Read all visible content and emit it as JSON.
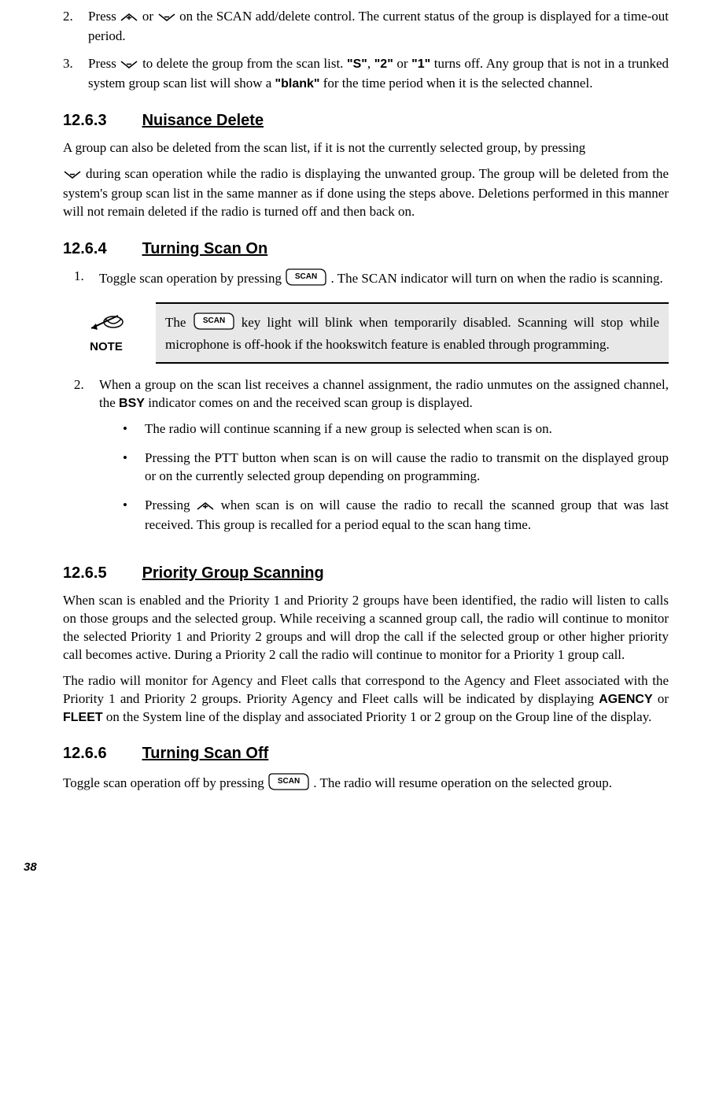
{
  "item2": {
    "num": "2.",
    "text_a": "Press ",
    "text_b": " or ",
    "text_c": " on the SCAN add/delete control. The current status of the group is displayed for a time-out period."
  },
  "item3": {
    "num": "3.",
    "text_a": "Press ",
    "text_b": " to delete the group from the scan list.  ",
    "q_s": "\"S\"",
    "comma1": ", ",
    "q_2": "\"2\"",
    "or": " or ",
    "q_1": "\"1\"",
    "text_c": " turns off. Any group that is not in a trunked system group scan list will show a ",
    "q_blank": "\"blank\"",
    "text_d": " for the time period when it is the selected channel."
  },
  "s1263": {
    "num": "12.6.3",
    "title": "Nuisance Delete"
  },
  "p1263a": "A group can also be deleted from the scan list, if it is not the currently selected group, by pressing",
  "p1263b": " during scan operation while the radio is displaying the unwanted group. The group will be deleted from the system's group scan list in the same manner as if done using the steps above. Deletions performed in this manner will not remain deleted if the radio is turned off and then back on.",
  "s1264": {
    "num": "12.6.4",
    "title": "Turning Scan On"
  },
  "li1264_1": {
    "num": "1.",
    "a": "Toggle scan operation by pressing ",
    "b": ". The SCAN indicator will turn on when the radio is scanning."
  },
  "note": {
    "label": "NOTE",
    "a": "The ",
    "b": " key light will blink when temporarily disabled. Scanning will stop while microphone is off-hook if the hookswitch feature is enabled through programming."
  },
  "li1264_2": {
    "num": "2.",
    "a": "When a group on the scan list receives a channel assignment, the radio unmutes on the assigned channel, the ",
    "bsy": "BSY",
    "b": " indicator comes on and the received scan group is displayed."
  },
  "sub1": "The radio will continue scanning if a new group is selected when scan is on.",
  "sub2": "Pressing the PTT button when scan is on will cause the radio to transmit on the displayed group or on the currently selected group depending on programming.",
  "sub3a": "Pressing ",
  "sub3b": " when scan is on will cause the radio to recall the scanned group that was last received. This group is recalled for a period equal to the scan hang time.",
  "s1265": {
    "num": "12.6.5",
    "title": "Priority Group Scanning"
  },
  "p1265a": "When scan is enabled and the Priority 1 and Priority 2 groups have been identified, the radio will listen to calls on those groups and the selected group.  While receiving a scanned group call, the radio will continue to monitor the selected Priority 1 and Priority 2 groups and will drop the call if the selected group or other higher priority call becomes active.  During a Priority 2 call the radio will continue to monitor for a Priority 1 group call.",
  "p1265b_a": "The radio will monitor for Agency and Fleet calls that correspond to the Agency and Fleet associated with the Priority 1 and Priority 2 groups. Priority Agency and Fleet calls will be indicated by displaying ",
  "agency": "AGENCY",
  "p1265b_or": " or ",
  "fleet": "FLEET",
  "p1265b_b": " on the System line of the display and associated Priority 1 or 2 group on the Group line of the display.",
  "s1266": {
    "num": "12.6.6",
    "title": "Turning Scan Off"
  },
  "p1266a": "Toggle scan operation off by pressing ",
  "p1266b": ".  The radio will resume operation on the selected group.",
  "page": "38",
  "scan_label": "SCAN"
}
